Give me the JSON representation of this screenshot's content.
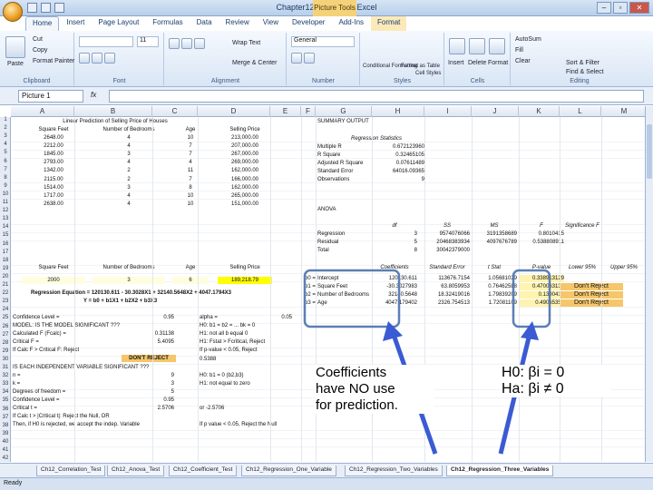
{
  "window": {
    "title": "Chapter12 - Microsoft Excel",
    "context_tab_title": "Picture Tools",
    "controls": [
      "–",
      "▫",
      "✕"
    ]
  },
  "tabs": [
    "Home",
    "Insert",
    "Page Layout",
    "Formulas",
    "Data",
    "Review",
    "View",
    "Developer",
    "Add-Ins",
    "Format"
  ],
  "ribbon": {
    "groups": [
      "Clipboard",
      "Font",
      "Alignment",
      "Number",
      "Styles",
      "Cells",
      "Editing"
    ],
    "items": {
      "paste": "Paste",
      "cut": "Cut",
      "copy": "Copy",
      "format_painter": "Format Painter",
      "font_size": "11",
      "wrap_text": "Wrap Text",
      "merge_center": "Merge & Center",
      "number_format": "General",
      "conditional_formatting": "Conditional Formatting",
      "format_as_table": "Format as Table",
      "cell_styles": "Cell Styles",
      "insert": "Insert",
      "delete": "Delete",
      "format": "Format",
      "autosum": "AutoSum",
      "fill": "Fill",
      "clear": "Clear",
      "sort_filter": "Sort & Filter",
      "find_select": "Find & Select"
    }
  },
  "formula_bar": {
    "name_box": "Picture 1",
    "fx": "fx"
  },
  "columns": [
    "A",
    "B",
    "C",
    "D",
    "E",
    "F",
    "G",
    "H",
    "I",
    "J",
    "K",
    "L",
    "M"
  ],
  "sheet": {
    "data_title": "Linear Prediction of Selling Price of Houses",
    "headers": [
      "Square Feet",
      "Number of Bedrooms",
      "Age",
      "Selling Price"
    ],
    "rows": [
      [
        "2648.00",
        "4",
        "10",
        "213,000.00"
      ],
      [
        "2212.00",
        "4",
        "7",
        "207,000.00"
      ],
      [
        "1845.00",
        "3",
        "7",
        "267,000.00"
      ],
      [
        "2793.00",
        "4",
        "4",
        "269,000.00"
      ],
      [
        "1342.00",
        "2",
        "11",
        "162,000.00"
      ],
      [
        "2115.00",
        "2",
        "7",
        "166,000.00"
      ],
      [
        "1514.00",
        "3",
        "8",
        "162,000.00"
      ],
      [
        "1717.00",
        "4",
        "10",
        "265,000.00"
      ],
      [
        "2638.00",
        "4",
        "10",
        "151,000.00"
      ]
    ],
    "predict_headers": [
      "Square Feet",
      "Number of Bedrooms",
      "Age",
      "Selling Price"
    ],
    "predict_values": [
      "2000",
      "3",
      "6",
      "189,218.79"
    ],
    "regression_equation": "Regression Equation = 120130.611 - 30.3028X1 + 32140.5648X2 + 4047.1794X3",
    "equation_form": "Y = b0 + b1X1 + b2X2 + b3X3",
    "summary_title": "SUMMARY OUTPUT",
    "regression_stats_title": "Regression Statistics",
    "regression_stats": [
      [
        "Multiple R",
        "0.672123960"
      ],
      [
        "R Square",
        "0.32465105"
      ],
      [
        "Adjusted R Square",
        "0.07611489"
      ],
      [
        "Standard Error",
        "64016.09365"
      ],
      [
        "Observations",
        "9"
      ]
    ],
    "anova_title": "ANOVA",
    "anova_headers": [
      "df",
      "SS",
      "MS",
      "F",
      "Significance F"
    ],
    "anova_rows": [
      [
        "Regression",
        "3",
        "9574076066",
        "3191358689",
        "0.8010415"
      ],
      [
        "Residual",
        "5",
        "20468383934",
        "4097676789",
        "0.538808911"
      ],
      [
        "Total",
        "8",
        "30042379000",
        "",
        ""
      ]
    ],
    "coef_headers": [
      "Coefficients",
      "Standard Error",
      "t Stat",
      "P-value",
      "Lower 95%",
      "Upper 95%"
    ],
    "coef_rows": [
      [
        "Intercept",
        "120130.611",
        "113676.7154",
        "1.05681029",
        "0.338913129",
        "",
        ""
      ],
      [
        "Square Feet",
        "-30.3027983",
        "63.8059953",
        "0.76462588",
        "0.470063134",
        "",
        ""
      ],
      [
        "Number of Bedrooms",
        "32140.5648",
        "18.32419016",
        "1.79839209",
        "0.1300417",
        "",
        ""
      ],
      [
        "Age",
        "4047.179402",
        "2326.754513",
        "1.72081109",
        "0.49065357",
        "",
        ""
      ]
    ],
    "coef_row_labels": [
      "b0 =",
      "b1 =",
      "b2 =",
      "b3 ="
    ],
    "dont_reject": [
      "Don't Reject",
      "Don't Reject",
      "Don't Reject"
    ],
    "tests": [
      [
        "Confidence Level =",
        "0.95",
        "alpha =",
        "0.05"
      ],
      [
        "MODEL: IS THE MODEL SIGNIFICANT ???",
        "",
        "H0: b1 = b2 = ... bk = 0",
        ""
      ],
      [
        "Calculated F (Fcalc) =",
        "0.31138",
        "H1: not all b equal 0",
        ""
      ],
      [
        "Critical F =",
        "5.4095",
        "H1: Fstat > Fcritical, Reject",
        ""
      ],
      [
        "If Calc F > Critical F: Reject",
        "DON'T REJECT",
        "If p-value < 0.05, Reject",
        ""
      ],
      [
        "",
        "p-value =",
        "0.5388",
        ""
      ],
      [
        "IS EACH INDEPENDENT VARIABLE SIGNIFICANT ???",
        "",
        "",
        ""
      ],
      [
        "n =",
        "9",
        "H0: b1 = 0 (b2,b3)",
        ""
      ],
      [
        "k =",
        "3",
        "H1: not equal to zero",
        ""
      ],
      [
        "Degrees of freedom =",
        "5",
        "",
        ""
      ],
      [
        "Confidence Level =",
        "0.95",
        "",
        ""
      ],
      [
        "Critical t =",
        "2.5706",
        "or -2.5706",
        ""
      ],
      [
        "If Calc t > |Critical t|: Reject the Null, OR",
        "",
        "",
        ""
      ],
      [
        "Then, if H0 is rejected, we accept the indep. Variable",
        "",
        "If p value < 0.05, Reject the Null",
        ""
      ]
    ]
  },
  "overlay": {
    "coef_note": [
      "Coefficients",
      "have NO use",
      "for prediction."
    ],
    "h0": "H0: βi = 0",
    "ha": "Ha: βi ≠ 0"
  },
  "sheet_tabs": [
    "Ch12_Correlation_Test",
    "Ch12_Anova_Test",
    "Ch12_Coefficient_Test",
    "Ch12_Regression_One_Variable",
    "Ch12_Regression_Two_Variables",
    "Ch12_Regression_Three_Variables"
  ],
  "status": {
    "ready": "Ready"
  },
  "colors": {
    "highlight_yellow": "#ffff00",
    "highlight_orange": "#f5c66a",
    "arrow_blue": "#3a5bd3",
    "callout_blue": "#5b7fb5"
  }
}
